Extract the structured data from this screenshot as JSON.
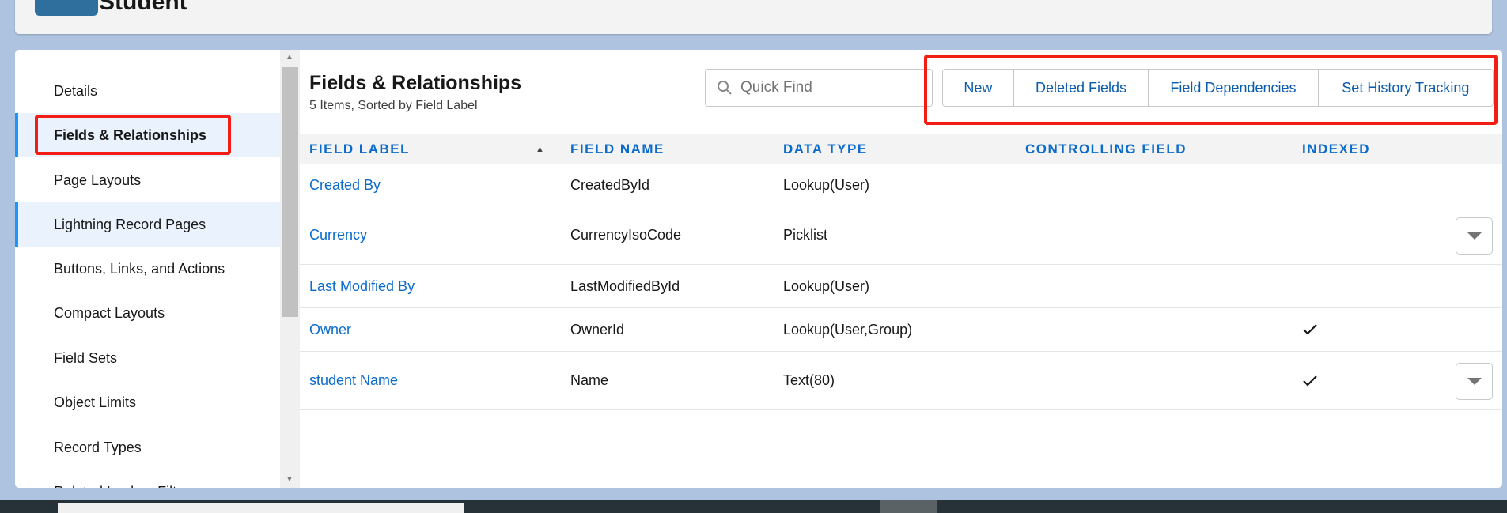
{
  "header": {
    "object_title": "Student"
  },
  "sidebar": {
    "items": [
      {
        "label": "Details"
      },
      {
        "label": "Fields & Relationships",
        "selected": true
      },
      {
        "label": "Page Layouts"
      },
      {
        "label": "Lightning Record Pages",
        "hover": true
      },
      {
        "label": "Buttons, Links, and Actions"
      },
      {
        "label": "Compact Layouts"
      },
      {
        "label": "Field Sets"
      },
      {
        "label": "Object Limits"
      },
      {
        "label": "Record Types"
      },
      {
        "label": "Related Lookup Filters"
      }
    ]
  },
  "main": {
    "title": "Fields & Relationships",
    "subtitle": "5 Items, Sorted by Field Label",
    "quick_find": {
      "placeholder": "Quick Find",
      "icon": "search-icon"
    },
    "buttons": [
      "New",
      "Deleted Fields",
      "Field Dependencies",
      "Set History Tracking"
    ],
    "columns": [
      "FIELD LABEL",
      "FIELD NAME",
      "DATA TYPE",
      "CONTROLLING FIELD",
      "INDEXED"
    ],
    "sort": {
      "column": "FIELD LABEL",
      "direction": "ascending"
    },
    "rows": [
      {
        "label": "Created By",
        "name": "CreatedById",
        "type": "Lookup(User)",
        "controlling": "",
        "indexed": false,
        "menu": false
      },
      {
        "label": "Currency",
        "name": "CurrencyIsoCode",
        "type": "Picklist",
        "controlling": "",
        "indexed": false,
        "menu": true
      },
      {
        "label": "Last Modified By",
        "name": "LastModifiedById",
        "type": "Lookup(User)",
        "controlling": "",
        "indexed": false,
        "menu": false
      },
      {
        "label": "Owner",
        "name": "OwnerId",
        "type": "Lookup(User,Group)",
        "controlling": "",
        "indexed": true,
        "menu": false
      },
      {
        "label": "student Name",
        "name": "Name",
        "type": "Text(80)",
        "controlling": "",
        "indexed": true,
        "menu": true
      }
    ]
  },
  "colors": {
    "link": "#0b6bcb",
    "highlight": "#f21d14",
    "selected_bg": "#eaf3fd"
  }
}
